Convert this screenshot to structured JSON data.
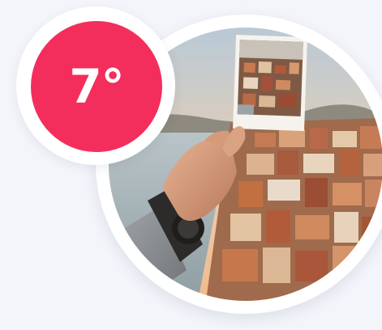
{
  "weather_badge": {
    "temperature": "7°",
    "color": "#f42e5c"
  },
  "photo": {
    "subject": "hand-holding-polaroid-over-city-photo"
  },
  "colors": {
    "background": "#f3f5fa",
    "ring": "#ffffff",
    "badge": "#f42e5c"
  }
}
